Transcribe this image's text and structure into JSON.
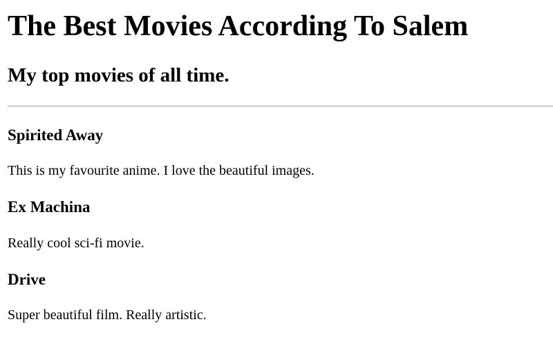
{
  "header": {
    "title": "The Best Movies According To Salem",
    "subtitle": "My top movies of all time."
  },
  "movies": [
    {
      "title": "Spirited Away",
      "description": "This is my favourite anime. I love the beautiful images."
    },
    {
      "title": "Ex Machina",
      "description": "Really cool sci-fi movie."
    },
    {
      "title": "Drive",
      "description": "Super beautiful film. Really artistic."
    }
  ]
}
